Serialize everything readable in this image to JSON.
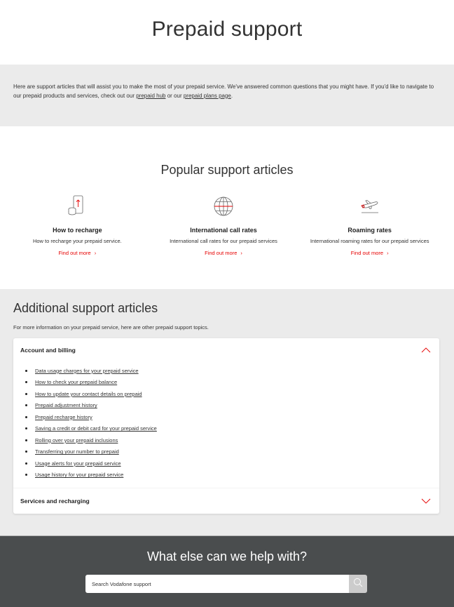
{
  "page": {
    "title": "Prepaid support"
  },
  "intro": {
    "text_before": "Here are support articles that will assist you to make the most of your prepaid service. We've answered common questions that you might have. If you'd like to navigate to our prepaid products and services, check out our ",
    "link1": "prepaid hub",
    "text_middle": " or our ",
    "link2": "prepaid plans page",
    "text_after": "."
  },
  "popular": {
    "heading": "Popular support articles",
    "cards": [
      {
        "icon": "phone-recharge-icon",
        "title": "How to recharge",
        "description": "How to recharge your prepaid service.",
        "link": "Find out more",
        "chevron": "›"
      },
      {
        "icon": "globe-icon",
        "title": "International call rates",
        "description": "International call rates for our prepaid services",
        "link": "Find out more",
        "chevron": "›"
      },
      {
        "icon": "airplane-takeoff-icon",
        "title": "Roaming rates",
        "description": "International roaming rates for our prepaid services",
        "link": "Find out more",
        "chevron": "›"
      }
    ]
  },
  "additional": {
    "heading": "Additional support articles",
    "subtitle": "For more information on your prepaid service, here are other prepaid support topics.",
    "sections": [
      {
        "label": "Account and billing",
        "expanded": true,
        "items": [
          "Data usage charges for your prepaid service",
          "How to check your prepaid balance",
          "How to update your contact details on prepaid",
          "Prepaid adjustment history",
          "Prepaid recharge history",
          "Saving a credit or debit card for your prepaid service",
          "Rolling over your prepaid inclusions",
          "Transferring your number to prepaid",
          "Usage alerts for your prepaid service",
          "Usage history for your prepaid service"
        ]
      },
      {
        "label": "Services and recharging",
        "expanded": false
      }
    ]
  },
  "footer": {
    "heading": "What else can we help with?",
    "search_placeholder": "Search Vodafone support"
  },
  "colors": {
    "accent": "#e60000",
    "gray_bg": "#ebebeb",
    "footer_bg": "#4a4d4e",
    "search_button": "#cccccc"
  }
}
